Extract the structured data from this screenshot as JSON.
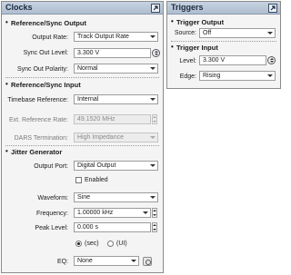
{
  "clocks": {
    "title": "Clocks",
    "ref_sync_output": {
      "heading": "Reference/Sync Output",
      "output_rate_label": "Output Rate:",
      "output_rate_value": "Track Output Rate",
      "sync_out_level_label": "Sync Out Level:",
      "sync_out_level_value": "3.300 V",
      "sync_out_polarity_label": "Sync Out Polarity:",
      "sync_out_polarity_value": "Normal"
    },
    "ref_sync_input": {
      "heading": "Reference/Sync Input",
      "timebase_label": "Timebase Reference:",
      "timebase_value": "Internal",
      "ext_ref_rate_label": "Ext. Reference Rate:",
      "ext_ref_rate_value": "49.1520 MHz",
      "dars_label": "DARS Termination:",
      "dars_value": "High Impedance"
    },
    "jitter": {
      "heading": "Jitter Generator",
      "output_port_label": "Output Port:",
      "output_port_value": "Digital Output",
      "enabled_label": "Enabled",
      "waveform_label": "Waveform:",
      "waveform_value": "Sine",
      "frequency_label": "Frequency:",
      "frequency_value": "1.00000 kHz",
      "peak_level_label": "Peak Level:",
      "peak_level_value": "0.000 s",
      "unit_sec": "(sec)",
      "unit_ui": "(UI)",
      "eq_label": "EQ:",
      "eq_value": "None"
    }
  },
  "triggers": {
    "title": "Triggers",
    "trigger_output": {
      "heading": "Trigger Output",
      "source_label": "Source:",
      "source_value": "Off"
    },
    "trigger_input": {
      "heading": "Trigger Input",
      "level_label": "Level:",
      "level_value": "3.300 V",
      "edge_label": "Edge:",
      "edge_value": "Rising"
    }
  },
  "colors": {
    "titlebar": "#b9c7d8",
    "panel_bg": "#f4f4f4",
    "border": "#8a8a8a"
  }
}
